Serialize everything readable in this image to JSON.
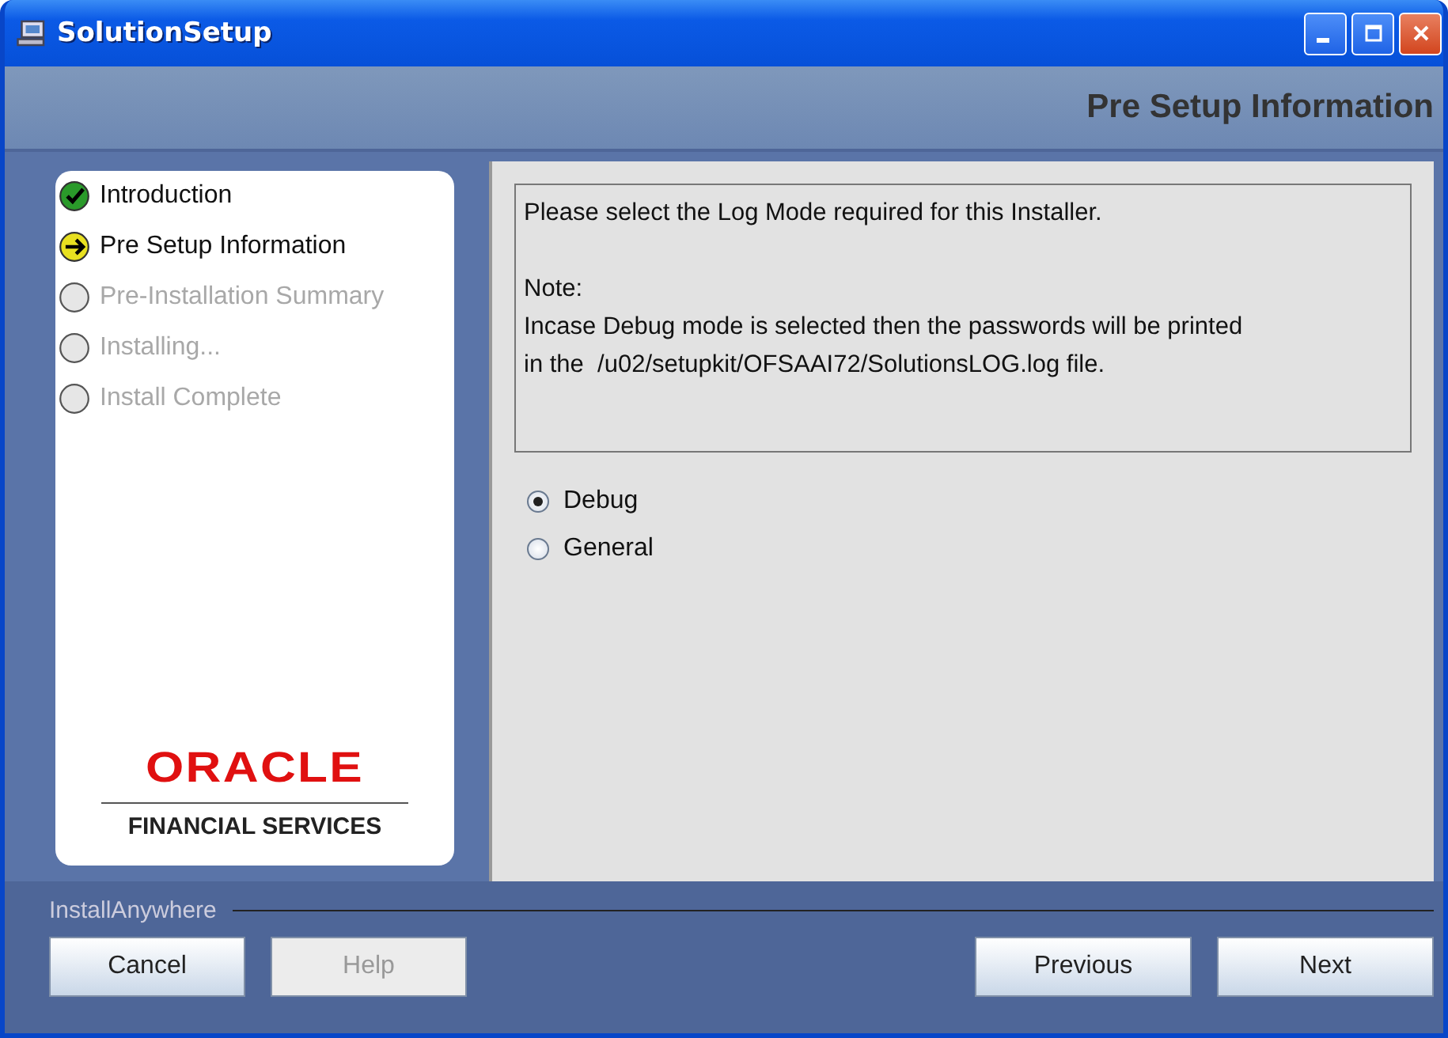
{
  "window": {
    "title": "SolutionSetup"
  },
  "header": {
    "title": "Pre Setup Information"
  },
  "steps": [
    {
      "label": "Introduction",
      "kind": "done"
    },
    {
      "label": "Pre Setup Information",
      "kind": "current"
    },
    {
      "label": "Pre-Installation Summary",
      "kind": "pending"
    },
    {
      "label": "Installing...",
      "kind": "pending"
    },
    {
      "label": "Install Complete",
      "kind": "pending"
    }
  ],
  "logo": {
    "brand": "ORACLE",
    "subtitle": "FINANCIAL SERVICES"
  },
  "message": {
    "intro": "Please select the Log Mode required for this Installer.",
    "note_lines": [
      "Note:",
      "Incase Debug mode is selected then the passwords will be printed",
      "in the  /u02/setupkit/OFSAAI72/SolutionsLOG.log file."
    ]
  },
  "options": [
    {
      "label": "Debug",
      "selected": true
    },
    {
      "label": "General",
      "selected": false
    }
  ],
  "footer": {
    "label": "InstallAnywhere"
  },
  "buttons_left": [
    {
      "label": "Cancel",
      "disabled": false
    },
    {
      "label": "Help",
      "disabled": true
    }
  ],
  "buttons_right": [
    {
      "label": "Previous",
      "disabled": false
    },
    {
      "label": "Next",
      "disabled": false
    }
  ]
}
